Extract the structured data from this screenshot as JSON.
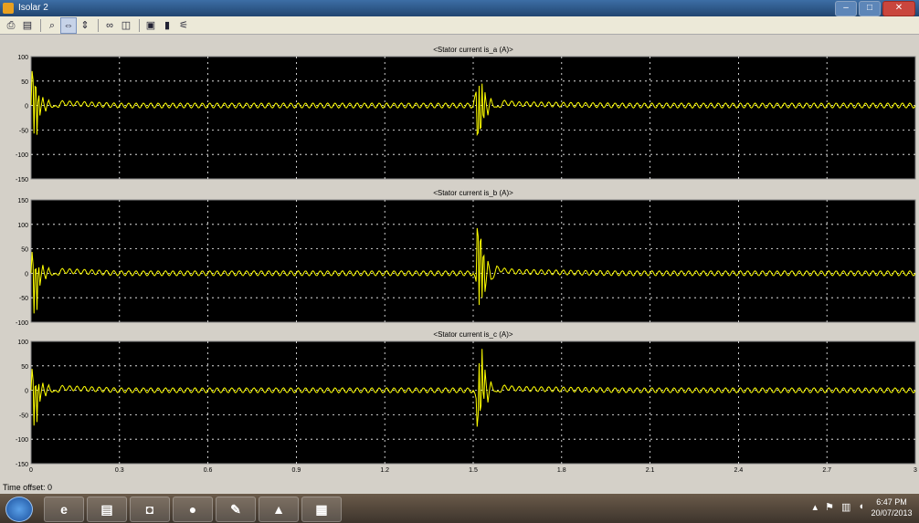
{
  "window": {
    "title": "Isolar 2"
  },
  "toolbar": {
    "icons": [
      "print-icon",
      "params-icon",
      "zoom-in-icon",
      "zoom-x-icon",
      "zoom-y-icon",
      "binoculars-icon",
      "autoscale-icon",
      "save-axes-icon",
      "floating-scope-icon",
      "signal-select-icon"
    ]
  },
  "colors": {
    "plot_bg": "#000000",
    "trace": "#ffff00",
    "grid": "#ffffff",
    "frame": "#d4d0c8"
  },
  "chart_data": [
    {
      "type": "line",
      "title": "<Stator current is_a (A)>",
      "xlim": [
        0,
        3
      ],
      "ylim": [
        -150,
        100
      ],
      "yticks": [
        -150,
        -100,
        -50,
        0,
        50,
        100
      ],
      "ytick_labels": [
        "-150",
        "-100",
        "-50",
        "0",
        "50",
        "100"
      ],
      "grid": true,
      "series": [
        {
          "x": [
            0,
            0.005,
            0.01,
            0.015,
            0.02,
            0.025,
            0.03,
            0.04,
            0.05,
            0.06,
            0.08,
            0.1,
            0.3,
            0.5,
            1.0,
            1.5,
            1.51,
            1.515,
            1.52,
            1.525,
            1.53,
            1.535,
            1.54,
            1.55,
            1.56,
            1.58,
            1.6,
            1.65,
            2.0,
            2.5,
            3.0
          ],
          "y": [
            0,
            100,
            -60,
            90,
            -55,
            40,
            -25,
            20,
            -12,
            8,
            -6,
            5,
            0,
            0,
            0,
            0,
            25,
            -100,
            45,
            -90,
            40,
            -55,
            30,
            -20,
            12,
            -8,
            6,
            3,
            0,
            0,
            0
          ]
        }
      ]
    },
    {
      "type": "line",
      "title": "<Stator current is_b (A)>",
      "xlim": [
        0,
        3
      ],
      "ylim": [
        -100,
        150
      ],
      "yticks": [
        -100,
        -50,
        0,
        50,
        100,
        150
      ],
      "ytick_labels": [
        "-100",
        "-50",
        "0",
        "50",
        "100",
        "150"
      ],
      "grid": true,
      "series": [
        {
          "x": [
            0,
            0.005,
            0.01,
            0.015,
            0.02,
            0.025,
            0.03,
            0.04,
            0.05,
            0.06,
            0.08,
            0.1,
            0.3,
            0.5,
            1.0,
            1.5,
            1.51,
            1.515,
            1.52,
            1.525,
            1.53,
            1.535,
            1.54,
            1.55,
            1.56,
            1.58,
            1.6,
            1.65,
            2.0,
            2.5,
            3.0
          ],
          "y": [
            0,
            60,
            -85,
            55,
            -70,
            30,
            -30,
            20,
            -12,
            8,
            -6,
            5,
            0,
            0,
            0,
            0,
            -20,
            150,
            -60,
            130,
            -55,
            70,
            -35,
            25,
            -15,
            10,
            6,
            3,
            0,
            0,
            0
          ]
        }
      ]
    },
    {
      "type": "line",
      "title": "<Stator current is_c (A)>",
      "xlim": [
        0,
        3
      ],
      "ylim": [
        -150,
        100
      ],
      "yticks": [
        -150,
        -100,
        -50,
        0,
        50,
        100
      ],
      "ytick_labels": [
        "-150",
        "-100",
        "-50",
        "0",
        "50",
        "100"
      ],
      "xticks": [
        0,
        0.3,
        0.6,
        0.9,
        1.2,
        1.5,
        1.8,
        2.1,
        2.4,
        2.7,
        3.0
      ],
      "xtick_labels": [
        "0",
        "0.3",
        "0.6",
        "0.9",
        "1.2",
        "1.5",
        "1.8",
        "2.1",
        "2.4",
        "2.7",
        "3"
      ],
      "grid": true,
      "series": [
        {
          "x": [
            0,
            0.005,
            0.01,
            0.015,
            0.02,
            0.025,
            0.03,
            0.04,
            0.05,
            0.06,
            0.08,
            0.1,
            0.3,
            0.5,
            1.0,
            1.5,
            1.51,
            1.515,
            1.52,
            1.525,
            1.53,
            1.535,
            1.54,
            1.55,
            1.56,
            1.58,
            1.6,
            1.65,
            2.0,
            2.5,
            3.0
          ],
          "y": [
            0,
            60,
            -75,
            50,
            -60,
            30,
            -28,
            18,
            -12,
            8,
            -6,
            5,
            0,
            0,
            0,
            0,
            -20,
            -100,
            60,
            -90,
            80,
            -50,
            45,
            -25,
            15,
            -8,
            6,
            3,
            0,
            0,
            0
          ]
        }
      ]
    }
  ],
  "status": {
    "time_offset": "Time offset: 0"
  },
  "taskbar": {
    "apps": [
      {
        "name": "ie-icon",
        "glyph": "e"
      },
      {
        "name": "explorer-icon",
        "glyph": "▤"
      },
      {
        "name": "media-player-icon",
        "glyph": "◘"
      },
      {
        "name": "firefox-icon",
        "glyph": "●"
      },
      {
        "name": "tool-icon",
        "glyph": "✎"
      },
      {
        "name": "matlab-icon",
        "glyph": "▲"
      },
      {
        "name": "simulink-icon",
        "glyph": "▦"
      }
    ],
    "tray_icons": [
      "up-arrow-icon",
      "flag-icon",
      "network-icon",
      "speaker-icon"
    ],
    "time": "6:47 PM",
    "date": "20/07/2013"
  }
}
